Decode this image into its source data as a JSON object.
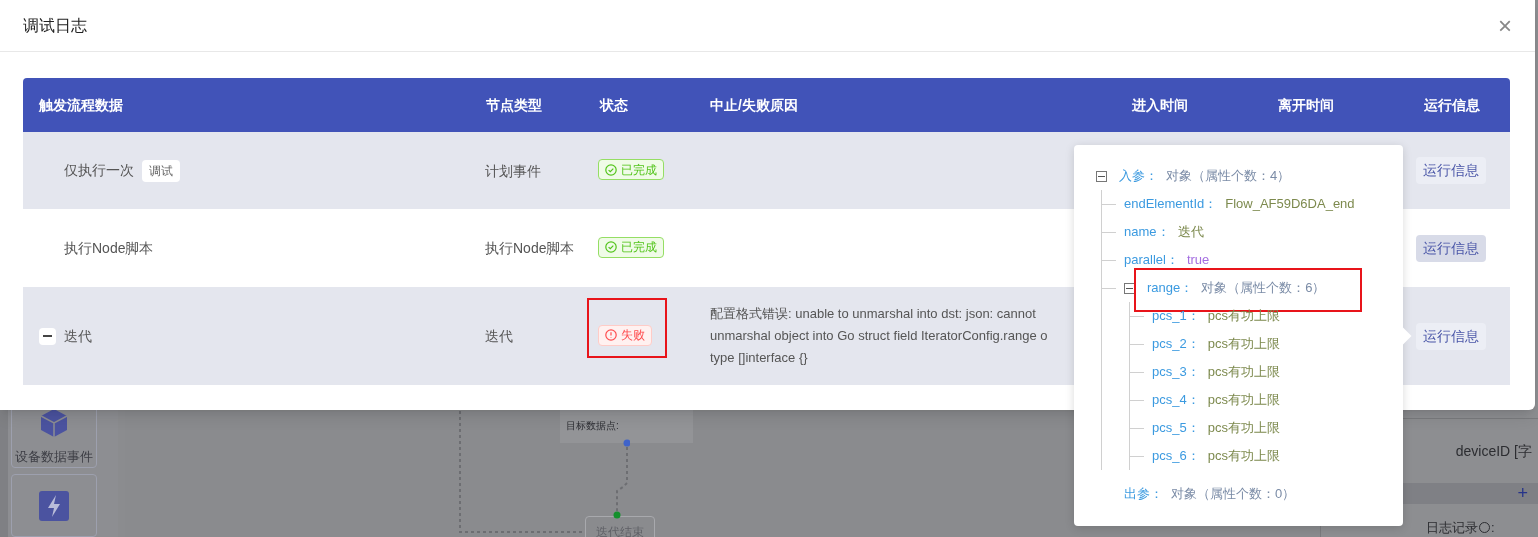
{
  "dialog": {
    "title": "调试日志",
    "close": "×"
  },
  "table": {
    "columns": [
      "触发流程数据",
      "节点类型",
      "状态",
      "中止/失败原因",
      "进入时间",
      "离开时间",
      "运行信息"
    ],
    "rows": [
      {
        "data": "仅执行一次",
        "tag": "调试",
        "node_type": "计划事件",
        "status": {
          "label": "已完成",
          "kind": "success"
        },
        "reason": [],
        "button": "运行信息",
        "hovered": false
      },
      {
        "data": "执行Node脚本",
        "node_type": "执行Node脚本",
        "status": {
          "label": "已完成",
          "kind": "success"
        },
        "reason": [],
        "button": "运行信息",
        "hovered": true
      },
      {
        "data": "迭代",
        "expanded": true,
        "node_type": "迭代",
        "status": {
          "label": "失败",
          "kind": "error",
          "highlighted": true
        },
        "reason": [
          "配置格式错误: unable to unmarshal into dst: json: cannot",
          "unmarshal object into Go struct field IteratorConfig.range o",
          "type []interface {}"
        ],
        "button": "运行信息",
        "hovered": false
      }
    ]
  },
  "popover": {
    "tree": [
      {
        "key": "入参：",
        "value": "对象（属性个数：4）",
        "kind": "object",
        "expanded": true,
        "children": [
          {
            "key": "endElementId：",
            "value": "Flow_AF59D6DA_end",
            "kind": "string"
          },
          {
            "key": "name：",
            "value": "迭代",
            "kind": "string"
          },
          {
            "key": "parallel：",
            "value": "true",
            "kind": "boolean"
          },
          {
            "key": "range：",
            "value": "对象（属性个数：6）",
            "kind": "object",
            "expanded": true,
            "highlighted": true,
            "children": [
              {
                "key": "pcs_1：",
                "value": "pcs有功上限",
                "kind": "string"
              },
              {
                "key": "pcs_2：",
                "value": "pcs有功上限",
                "kind": "string"
              },
              {
                "key": "pcs_3：",
                "value": "pcs有功上限",
                "kind": "string"
              },
              {
                "key": "pcs_4：",
                "value": "pcs有功上限",
                "kind": "string"
              },
              {
                "key": "pcs_5：",
                "value": "pcs有功上限",
                "kind": "string"
              },
              {
                "key": "pcs_6：",
                "value": "pcs有功上限",
                "kind": "string"
              }
            ]
          }
        ]
      },
      {
        "key": "出参：",
        "value": "对象（属性个数：0）",
        "kind": "object"
      }
    ]
  },
  "background": {
    "sidebar": [
      {
        "label": "设备数据事件",
        "kind": "cube"
      },
      {
        "kind": "lightning"
      }
    ],
    "nodes": [
      {
        "label": "目标数据点:",
        "kind": "card"
      },
      {
        "label": "迭代结束",
        "kind": "end"
      }
    ],
    "panel": {
      "field": "deviceID [字",
      "add": "+",
      "log_label": "日志记录",
      "log_colon": ":"
    }
  }
}
